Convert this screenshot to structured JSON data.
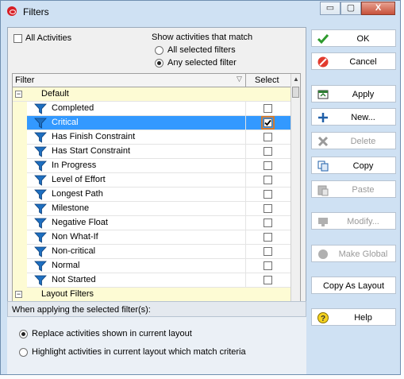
{
  "window": {
    "title": "Filters",
    "controls": {
      "minimize": "▭",
      "maximize": "▢",
      "close": "X"
    }
  },
  "top": {
    "all_activities_label": "All Activities",
    "show_match_label": "Show activities that match",
    "match_options": [
      {
        "label": "All selected filters",
        "selected": false
      },
      {
        "label": "Any selected filter",
        "selected": true
      }
    ]
  },
  "grid": {
    "columns": {
      "filter": "Filter",
      "select": "Select"
    },
    "rows": [
      {
        "type": "group",
        "label": "Default",
        "expander": "−"
      },
      {
        "type": "item",
        "label": "Completed",
        "checked": false
      },
      {
        "type": "item",
        "label": "Critical",
        "checked": true,
        "selected": true
      },
      {
        "type": "item",
        "label": "Has Finish Constraint",
        "checked": false
      },
      {
        "type": "item",
        "label": "Has Start Constraint",
        "checked": false
      },
      {
        "type": "item",
        "label": "In Progress",
        "checked": false
      },
      {
        "type": "item",
        "label": "Level of Effort",
        "checked": false
      },
      {
        "type": "item",
        "label": "Longest Path",
        "checked": false
      },
      {
        "type": "item",
        "label": "Milestone",
        "checked": false
      },
      {
        "type": "item",
        "label": "Negative Float",
        "checked": false
      },
      {
        "type": "item",
        "label": "Non What-If",
        "checked": false
      },
      {
        "type": "item",
        "label": "Non-critical",
        "checked": false
      },
      {
        "type": "item",
        "label": "Normal",
        "checked": false
      },
      {
        "type": "item",
        "label": "Not Started",
        "checked": false
      },
      {
        "type": "group",
        "label": "Layout Filters",
        "expander": "−"
      }
    ]
  },
  "bottom": {
    "heading": "When applying the selected filter(s):",
    "options": [
      {
        "label": "Replace activities shown in current layout",
        "selected": true
      },
      {
        "label": "Highlight activities in current layout which match criteria",
        "selected": false
      }
    ]
  },
  "buttons": [
    {
      "label": "OK",
      "enabled": true,
      "icon": "check-icon"
    },
    {
      "label": "Cancel",
      "enabled": true,
      "icon": "cancel-icon"
    },
    {
      "label": "Apply",
      "enabled": true,
      "icon": "apply-icon"
    },
    {
      "label": "New...",
      "enabled": true,
      "icon": "plus-icon"
    },
    {
      "label": "Delete",
      "enabled": false,
      "icon": "delete-x-icon"
    },
    {
      "label": "Copy",
      "enabled": true,
      "icon": "copy-icon"
    },
    {
      "label": "Paste",
      "enabled": false,
      "icon": "paste-icon"
    },
    {
      "label": "Modify...",
      "enabled": false,
      "icon": "monitor-icon"
    },
    {
      "label": "Make Global",
      "enabled": false,
      "icon": "globe-icon"
    },
    {
      "label": "Copy As Layout",
      "enabled": true,
      "icon": null
    },
    {
      "label": "Help",
      "enabled": true,
      "icon": "help-icon"
    }
  ],
  "colors": {
    "selection": "#3399ff",
    "group_row": "#fdfbd4",
    "filter_icon": "#1e6fc0",
    "window_bg": "#cfe1f3"
  }
}
